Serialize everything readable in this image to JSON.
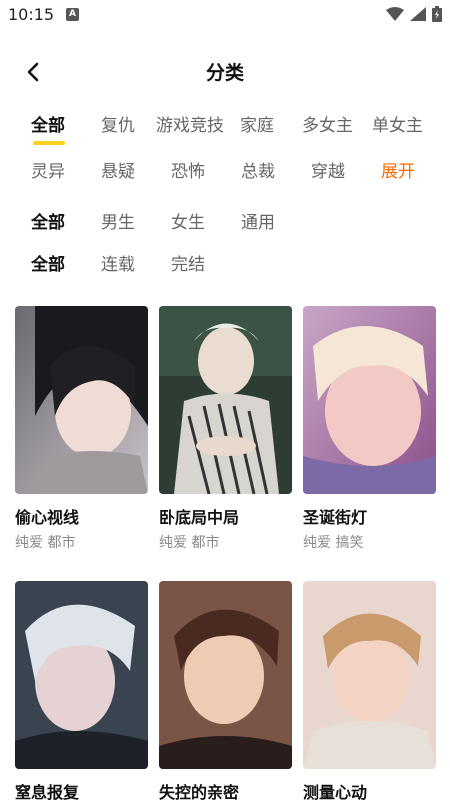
{
  "status": {
    "time": "10:15",
    "notif_icon": "A"
  },
  "header": {
    "title": "分类"
  },
  "filters": {
    "genres_row1": [
      "全部",
      "复仇",
      "游戏竞技",
      "家庭",
      "多女主",
      "单女主"
    ],
    "genres_row2": [
      "灵异",
      "悬疑",
      "恐怖",
      "总裁",
      "穿越"
    ],
    "expand": "展开",
    "audience": [
      "全部",
      "男生",
      "女生",
      "通用"
    ],
    "status": [
      "全部",
      "连载",
      "完结"
    ]
  },
  "cards": [
    {
      "title": "偷心视线",
      "tags": "纯爱  都市",
      "icon": "manga-cover"
    },
    {
      "title": "卧底局中局",
      "tags": "纯爱  都市",
      "icon": "manga-cover"
    },
    {
      "title": "圣诞街灯",
      "tags": "纯爱  搞笑",
      "icon": "manga-cover"
    },
    {
      "title": "窒息报复",
      "tags": "",
      "icon": "manga-cover"
    },
    {
      "title": "失控的亲密",
      "tags": "",
      "icon": "manga-cover"
    },
    {
      "title": "测量心动",
      "tags": "",
      "icon": "manga-cover"
    }
  ],
  "colors": {
    "accent": "#ff6a00",
    "underline": "#ffd21f"
  }
}
